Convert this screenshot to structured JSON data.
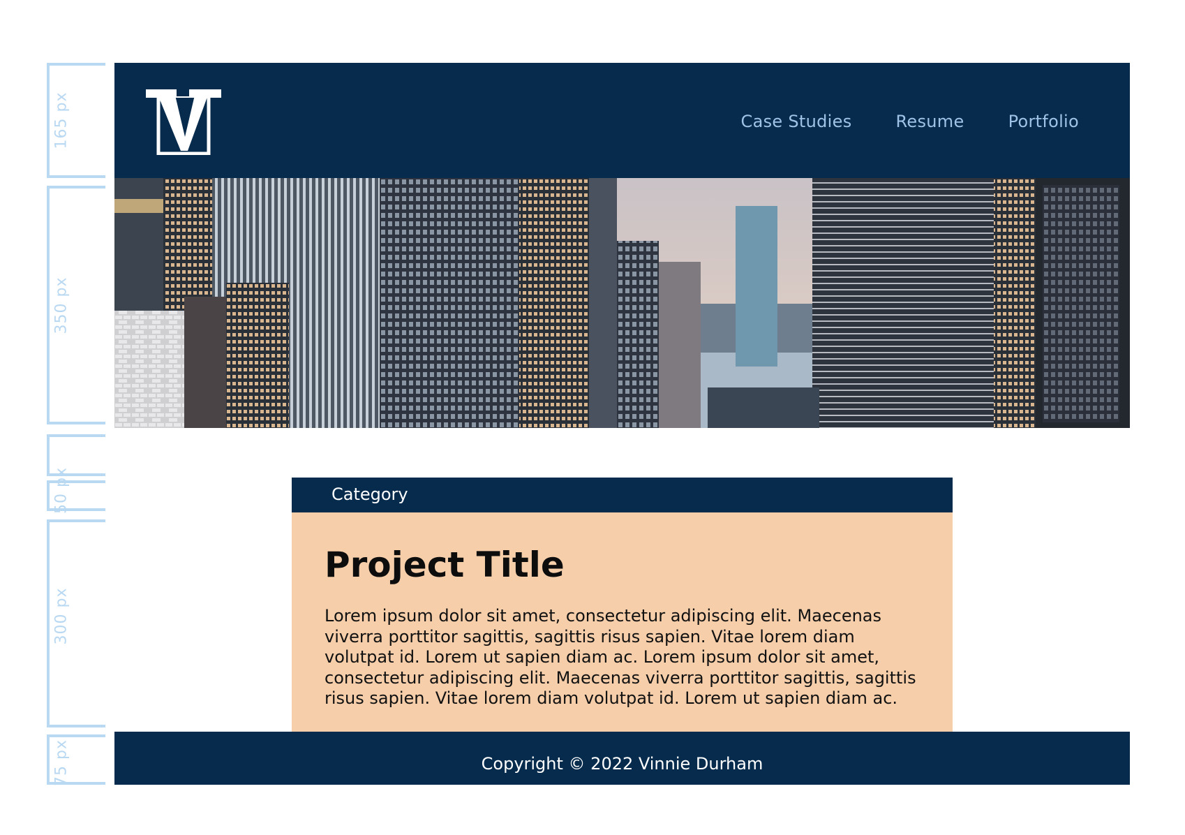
{
  "annotations": {
    "header_height": "165 px",
    "hero_height": "350 px",
    "category_height": "50 px",
    "body_height": "300 px",
    "footer_height": "75 px"
  },
  "header": {
    "logo_letter": "V",
    "nav": [
      "Case Studies",
      "Resume",
      "Portfolio"
    ]
  },
  "hero": {
    "image": "city-skyline-photo"
  },
  "card": {
    "category": "Category",
    "title": "Project Title",
    "body": "Lorem ipsum dolor sit amet, consectetur adipiscing elit. Maecenas viverra porttitor sagittis, sagittis risus sapien. Vitae lorem diam volutpat id. Lorem ut sapien diam ac. Lorem ipsum dolor sit amet, consectetur adipiscing elit. Maecenas viverra porttitor sagittis, sagittis risus sapien. Vitae lorem diam volutpat id. Lorem ut sapien diam ac."
  },
  "footer": {
    "copyright": "Copyright © 2022 Vinnie Durham"
  },
  "colors": {
    "navy": "#062b4d",
    "peach": "#f6ceaa",
    "nav_link": "#9ec3e6",
    "ruler": "#b9d8f2"
  }
}
